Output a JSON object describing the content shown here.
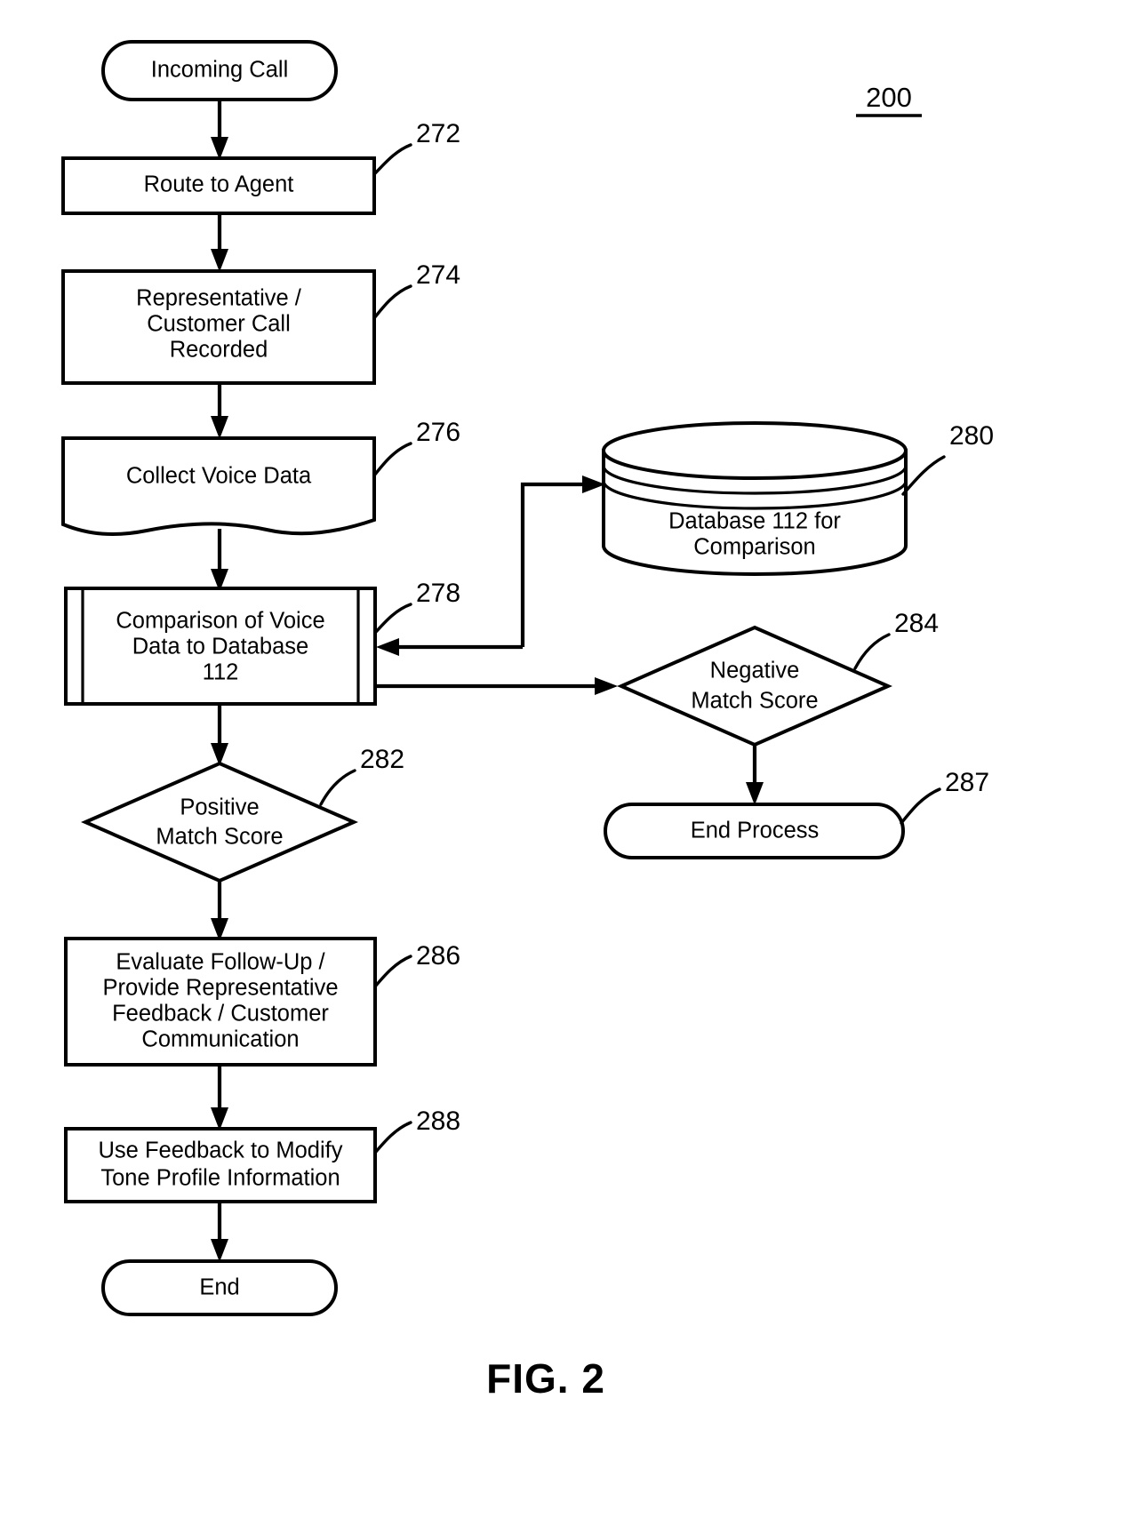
{
  "figure": {
    "title": "FIG. 2",
    "diagram_number": "200"
  },
  "nodes": {
    "incoming_call": {
      "label": "Incoming Call",
      "shape": "terminator"
    },
    "route_to_agent": {
      "label": "Route to Agent",
      "shape": "process",
      "ref": "272"
    },
    "call_recorded": {
      "line1": "Representative /",
      "line2": "Customer Call",
      "line3": "Recorded",
      "shape": "process",
      "ref": "274"
    },
    "collect_voice_data": {
      "label": "Collect Voice Data",
      "shape": "document",
      "ref": "276"
    },
    "comparison": {
      "line1": "Comparison of Voice",
      "line2": "Data to Database",
      "line3": "112",
      "shape": "predefined-process",
      "ref": "278"
    },
    "database": {
      "line1": "Database 112 for",
      "line2": "Comparison",
      "shape": "cylinder",
      "ref": "280"
    },
    "positive_match": {
      "line1": "Positive",
      "line2": "Match Score",
      "shape": "decision",
      "ref": "282"
    },
    "negative_match": {
      "line1": "Negative",
      "line2": "Match Score",
      "shape": "decision",
      "ref": "284"
    },
    "end_process": {
      "label": "End Process",
      "shape": "terminator",
      "ref": "287"
    },
    "evaluate_followup": {
      "line1": "Evaluate  Follow-Up /",
      "line2": "Provide Representative",
      "line3": "Feedback / Customer",
      "line4": "Communication",
      "shape": "process",
      "ref": "286"
    },
    "use_feedback": {
      "line1": "Use Feedback to Modify",
      "line2": "Tone Profile Information",
      "shape": "process",
      "ref": "288"
    },
    "end": {
      "label": "End",
      "shape": "terminator"
    }
  },
  "colors": {
    "stroke": "#000000",
    "fill": "#ffffff"
  }
}
